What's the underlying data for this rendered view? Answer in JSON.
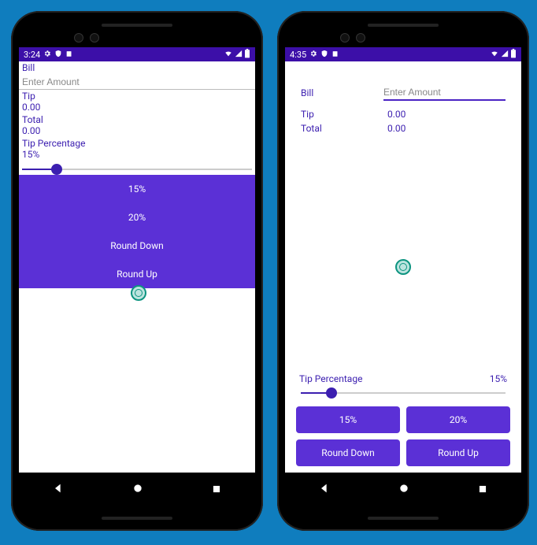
{
  "left": {
    "statusbar": {
      "time": "3:24"
    },
    "bill_label": "Bill",
    "bill_placeholder": "Enter Amount",
    "tip_label": "Tip",
    "tip_value": "0.00",
    "total_label": "Total",
    "total_value": "0.00",
    "tp_label": "Tip Percentage",
    "tp_value": "15%",
    "slider_percent": 15,
    "buttons": [
      "15%",
      "20%",
      "Round Down",
      "Round Up"
    ]
  },
  "right": {
    "statusbar": {
      "time": "4:35"
    },
    "bill_label": "Bill",
    "bill_placeholder": "Enter Amount",
    "tip_label": "Tip",
    "tip_value": "0.00",
    "total_label": "Total",
    "total_value": "0.00",
    "tp_label": "Tip Percentage",
    "tp_value": "15%",
    "slider_percent": 15,
    "buttons": [
      "15%",
      "20%",
      "Round Down",
      "Round Up"
    ]
  },
  "colors": {
    "primary": "#5b30d6",
    "primary_dark": "#3c0fa8",
    "text_primary": "#3c1fb0"
  }
}
